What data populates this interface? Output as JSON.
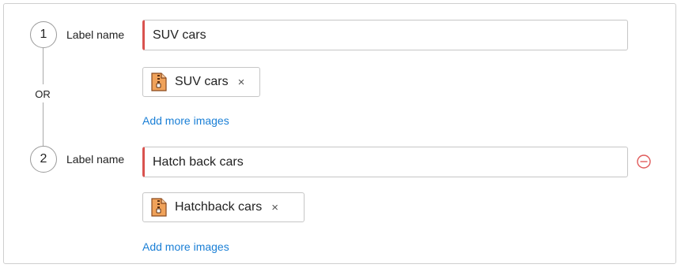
{
  "connector_label": "OR",
  "accent_colors": {
    "required_border": "#d9534f",
    "link": "#1a7fd6",
    "remove": "#e05a5a"
  },
  "items": [
    {
      "number": "1",
      "label": "Label name",
      "value": "SUV cars",
      "chip_label": "SUV cars",
      "chip_icon": "zip-file-icon",
      "add_link": "Add more images"
    },
    {
      "number": "2",
      "label": "Label name",
      "value": "Hatch back cars",
      "chip_label": "Hatchback cars",
      "chip_icon": "zip-file-icon",
      "add_link": "Add more images",
      "remove_icon": "minus-circle-icon"
    }
  ]
}
